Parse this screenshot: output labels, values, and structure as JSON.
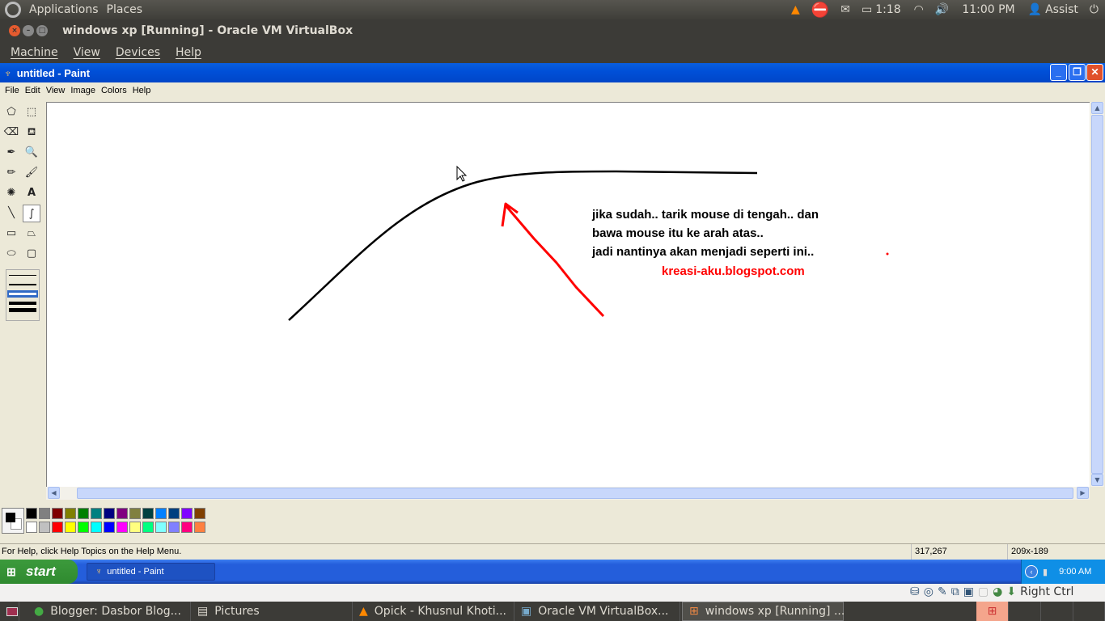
{
  "top_panel": {
    "applications": "Applications",
    "places": "Places",
    "battery_time": "1:18",
    "clock": "11:00 PM",
    "user": "Assist"
  },
  "vbox": {
    "title": "windows xp [Running] - Oracle VM VirtualBox",
    "menu": [
      "Machine",
      "View",
      "Devices",
      "Help"
    ],
    "host_key": "Right Ctrl"
  },
  "paint": {
    "title": "untitled - Paint",
    "menu": [
      "File",
      "Edit",
      "View",
      "Image",
      "Colors",
      "Help"
    ],
    "canvas_text": [
      "jika sudah.. tarik mouse di tengah.. dan",
      "bawa mouse itu ke arah atas..",
      "jadi nantinya akan menjadi seperti ini.."
    ],
    "canvas_link": "kreasi-aku.blogspot.com",
    "status_help": "For Help, click Help Topics on the Help Menu.",
    "coords": "317,267",
    "size": "209x-189",
    "palette_top": [
      "#000000",
      "#808080",
      "#800000",
      "#808000",
      "#008000",
      "#008080",
      "#000080",
      "#800080",
      "#808040",
      "#004040",
      "#0080ff",
      "#004080",
      "#8000ff",
      "#804000"
    ],
    "palette_bottom": [
      "#ffffff",
      "#c0c0c0",
      "#ff0000",
      "#ffff00",
      "#00ff00",
      "#00ffff",
      "#0000ff",
      "#ff00ff",
      "#ffff80",
      "#00ff80",
      "#80ffff",
      "#8080ff",
      "#ff0080",
      "#ff8040"
    ],
    "tools": [
      "free-select",
      "rect-select",
      "eraser",
      "fill",
      "color-picker",
      "magnifier",
      "pencil",
      "brush",
      "airbrush",
      "text",
      "line",
      "curve",
      "rectangle",
      "polygon",
      "ellipse",
      "rounded-rectangle"
    ]
  },
  "xp_taskbar": {
    "start": "start",
    "task": "untitled - Paint",
    "clock": "9:00 AM"
  },
  "bottom_panel": {
    "items": [
      "Blogger: Dasbor Blog...",
      "Pictures",
      "Opick - Khusnul Khoti...",
      "Oracle VM VirtualBox...",
      "windows xp [Running] ..."
    ]
  }
}
